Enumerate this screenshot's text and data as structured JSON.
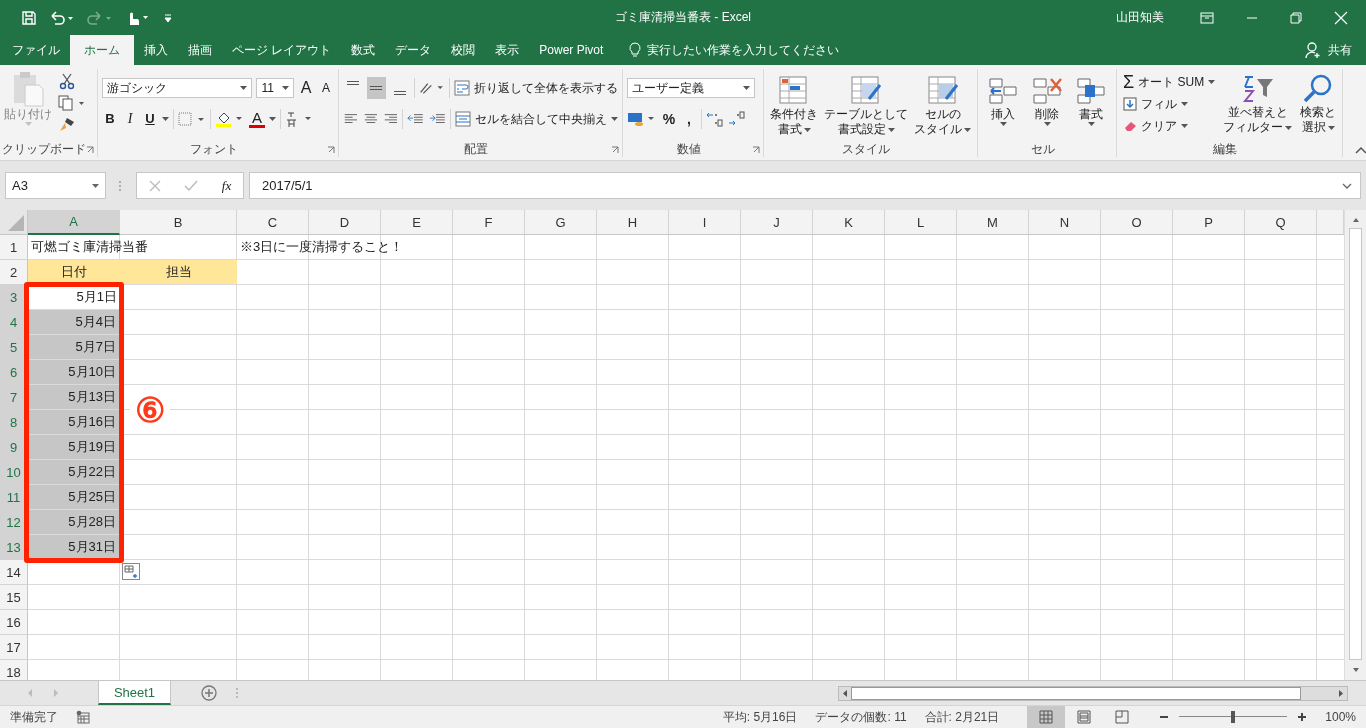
{
  "title_bar": {
    "title": "ゴミ庫清掃当番表  -  Excel",
    "user": "山田知美",
    "redo_disabled": true
  },
  "menu_tabs": [
    {
      "label": "ファイル",
      "selected": false
    },
    {
      "label": "ホーム",
      "selected": true
    },
    {
      "label": "挿入",
      "selected": false
    },
    {
      "label": "描画",
      "selected": false
    },
    {
      "label": "ページ レイアウト",
      "selected": false
    },
    {
      "label": "数式",
      "selected": false
    },
    {
      "label": "データ",
      "selected": false
    },
    {
      "label": "校閲",
      "selected": false
    },
    {
      "label": "表示",
      "selected": false
    },
    {
      "label": "Power Pivot",
      "selected": false
    }
  ],
  "tell_me": {
    "placeholder": "実行したい作業を入力してください"
  },
  "share": "共有",
  "ribbon": {
    "clipboard": {
      "label": "クリップボード",
      "paste": "貼り付け",
      "paste_disabled": true
    },
    "font": {
      "label": "フォント",
      "font_name": "游ゴシック",
      "font_size": "11",
      "size_buttons": [
        "A",
        "A"
      ],
      "style_buttons": [
        "B",
        "I",
        "U"
      ],
      "font_color_button": "A"
    },
    "alignment": {
      "label": "配置",
      "vertical": [
        {
          "selected": false
        },
        {
          "selected": true
        },
        {
          "selected": false
        }
      ],
      "wrap_text": "折り返して全体を表示する",
      "merge_center": "セルを結合して中央揃え"
    },
    "number": {
      "label": "数値",
      "format": "ユーザー定義",
      "buttons": [
        "%",
        ","
      ]
    },
    "styles": {
      "label": "スタイル",
      "buttons": [
        [
          "条件付き",
          "書式"
        ],
        [
          "テーブルとして",
          "書式設定"
        ],
        [
          "セルの",
          "スタイル"
        ]
      ]
    },
    "cells": {
      "label": "セル",
      "buttons": [
        "挿入",
        "削除",
        "書式"
      ]
    },
    "editing": {
      "label": "編集",
      "autosum_symbol": "Σ",
      "autosum": "オート SUM",
      "fill": "フィル",
      "clear": "クリア",
      "sort": [
        "並べ替えと",
        "フィルター"
      ],
      "find": [
        "検索と",
        "選択"
      ]
    }
  },
  "formula_bar": {
    "name_box": "A3",
    "function_label": "fx",
    "formula": "2017/5/1"
  },
  "sheet": {
    "columns": [
      {
        "label": "A",
        "selected": true
      },
      {
        "label": "B",
        "selected": false
      },
      {
        "label": "C",
        "selected": false
      },
      {
        "label": "D",
        "selected": false
      },
      {
        "label": "E",
        "selected": false
      },
      {
        "label": "F",
        "selected": false
      },
      {
        "label": "G",
        "selected": false
      },
      {
        "label": "H",
        "selected": false
      },
      {
        "label": "I",
        "selected": false
      },
      {
        "label": "J",
        "selected": false
      },
      {
        "label": "K",
        "selected": false
      },
      {
        "label": "L",
        "selected": false
      },
      {
        "label": "M",
        "selected": false
      },
      {
        "label": "N",
        "selected": false
      },
      {
        "label": "O",
        "selected": false
      },
      {
        "label": "P",
        "selected": false
      },
      {
        "label": "Q",
        "selected": false
      }
    ],
    "rows": [
      {
        "label": "1",
        "selected": false,
        "kind": "title",
        "cells": [
          "可燃ゴミ庫清掃当番",
          "※3日に一度清掃すること！"
        ]
      },
      {
        "label": "2",
        "selected": false,
        "kind": "header",
        "cells": [
          "日付",
          "担当"
        ]
      },
      {
        "label": "3",
        "selected": true,
        "kind": "date",
        "active": true,
        "cells": [
          "5月1日"
        ]
      },
      {
        "label": "4",
        "selected": true,
        "kind": "date",
        "active": false,
        "cells": [
          "5月4日"
        ]
      },
      {
        "label": "5",
        "selected": true,
        "kind": "date",
        "active": false,
        "cells": [
          "5月7日"
        ]
      },
      {
        "label": "6",
        "selected": true,
        "kind": "date",
        "active": false,
        "cells": [
          "5月10日"
        ]
      },
      {
        "label": "7",
        "selected": true,
        "kind": "date",
        "active": false,
        "cells": [
          "5月13日"
        ]
      },
      {
        "label": "8",
        "selected": true,
        "kind": "date",
        "active": false,
        "cells": [
          "5月16日"
        ]
      },
      {
        "label": "9",
        "selected": true,
        "kind": "date",
        "active": false,
        "cells": [
          "5月19日"
        ]
      },
      {
        "label": "10",
        "selected": true,
        "kind": "date",
        "active": false,
        "cells": [
          "5月22日"
        ]
      },
      {
        "label": "11",
        "selected": true,
        "kind": "date",
        "active": false,
        "cells": [
          "5月25日"
        ]
      },
      {
        "label": "12",
        "selected": true,
        "kind": "date",
        "active": false,
        "cells": [
          "5月28日"
        ]
      },
      {
        "label": "13",
        "selected": true,
        "kind": "date",
        "active": false,
        "cells": [
          "5月31日"
        ]
      },
      {
        "label": "14",
        "selected": false,
        "kind": "empty"
      },
      {
        "label": "15",
        "selected": false,
        "kind": "empty"
      },
      {
        "label": "16",
        "selected": false,
        "kind": "empty"
      },
      {
        "label": "17",
        "selected": false,
        "kind": "empty"
      },
      {
        "label": "18",
        "selected": false,
        "kind": "empty"
      }
    ],
    "annotation": {
      "label": "⑥"
    }
  },
  "sheet_tabs": [
    {
      "label": "Sheet1",
      "selected": true
    }
  ],
  "status_bar": {
    "ready": "準備完了",
    "average": "平均: 5月16日",
    "count": "データの個数: 11",
    "sum": "合計: 2月21日",
    "views": [
      {
        "selected": true
      },
      {
        "selected": false
      },
      {
        "selected": false
      }
    ],
    "zoom": {
      "level": 0.5,
      "label": "100%"
    }
  }
}
